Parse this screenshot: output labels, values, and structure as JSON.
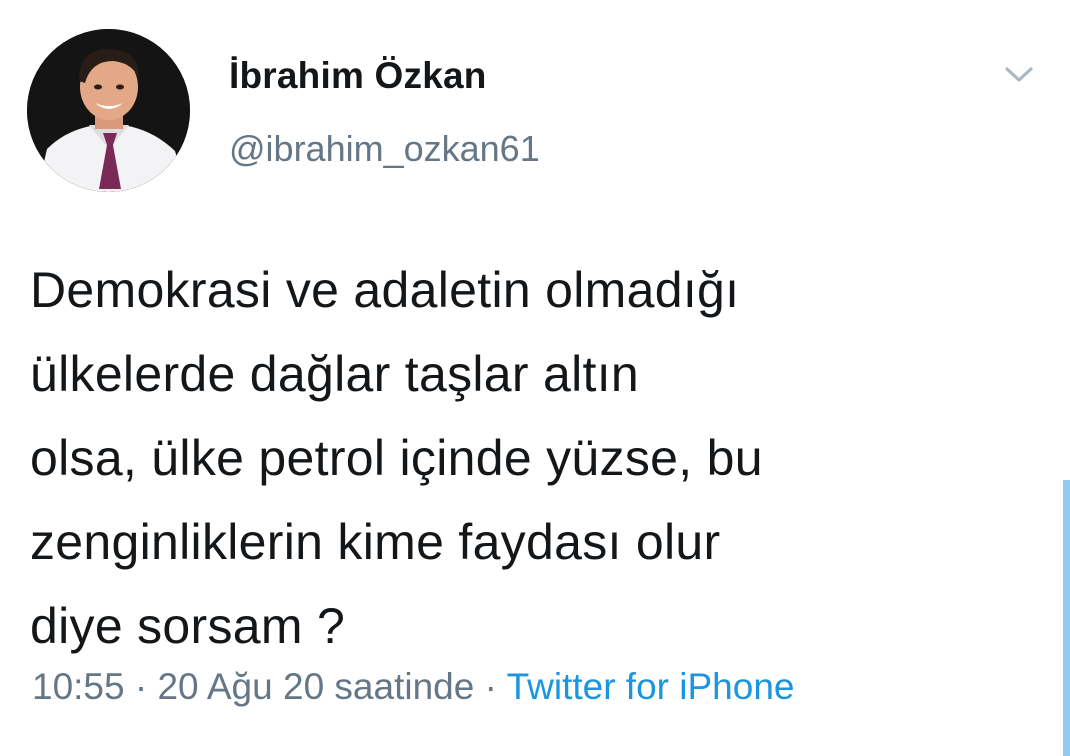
{
  "author": {
    "display_name": "İbrahim Özkan",
    "handle": "@ibrahim_ozkan61"
  },
  "tweet": {
    "lines": [
      "Demokrasi ve adaletin olmadığı",
      "ülkelerde dağlar taşlar altın",
      "olsa, ülke petrol içinde yüzse, bu",
      "zenginliklerin kime faydası olur",
      "diye sorsam ?"
    ]
  },
  "meta": {
    "time": "10:55",
    "separator": "·",
    "date": "20 Ağu 20 saatinde",
    "source": "Twitter for iPhone"
  },
  "icons": {
    "menu": "chevron-down-icon",
    "avatar": "profile-photo"
  },
  "colors": {
    "text": "#14171a",
    "secondary": "#657786",
    "link": "#1b95e0"
  }
}
